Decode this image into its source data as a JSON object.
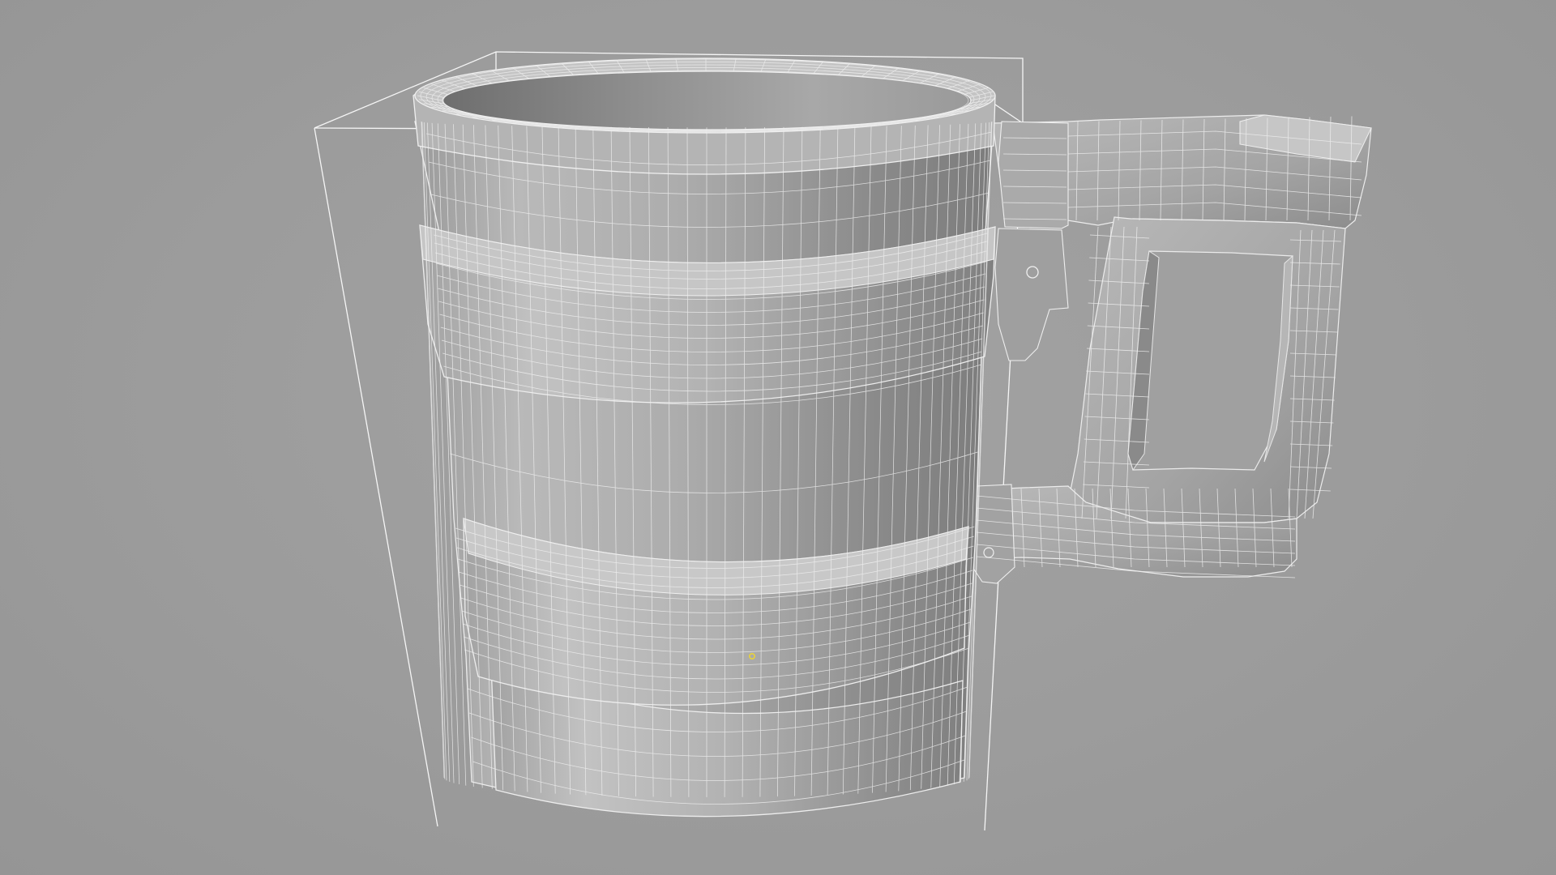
{
  "viewport": {
    "background_color": "#9c9c9c",
    "wire_color": "#f2f2f2",
    "bounding_box_color": "#ffffff",
    "selection_point_color": "#e8d23a"
  },
  "model": {
    "object": "mug",
    "display_mode": "wireframe-on-shaded",
    "parts": [
      "mug-body",
      "rim",
      "upper-band",
      "lower-band",
      "base",
      "handle"
    ]
  }
}
